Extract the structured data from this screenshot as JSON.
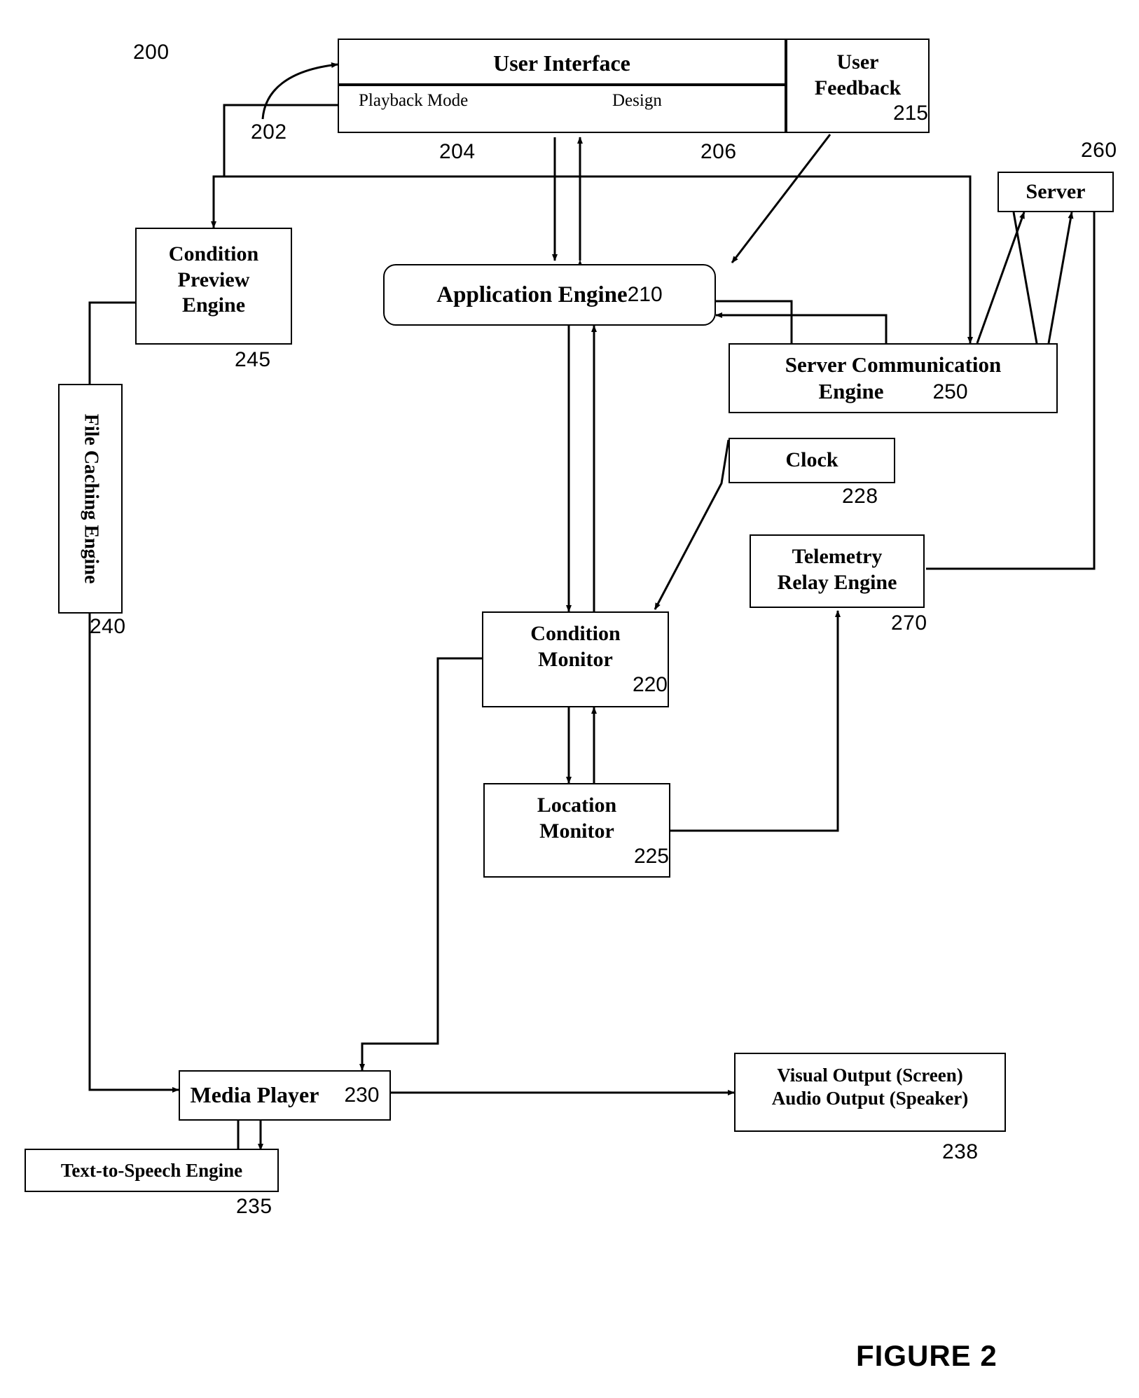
{
  "figure": {
    "caption": "FIGURE 2",
    "system_ref": "200",
    "ui_callout_ref": "202"
  },
  "blocks": {
    "user_interface": {
      "title": "User Interface",
      "tab_playback": "Playback Mode",
      "tab_design": "Design",
      "ref_playback": "204",
      "ref_design": "206"
    },
    "user_feedback": {
      "line1": "User",
      "line2": "Feedback",
      "ref": "215"
    },
    "server": {
      "label": "Server",
      "ref": "260"
    },
    "condition_preview_engine": {
      "line1": "Condition",
      "line2": "Preview",
      "line3": "Engine",
      "ref": "245"
    },
    "file_caching_engine": {
      "label": "File Caching Engine",
      "ref": "240"
    },
    "application_engine": {
      "label": "Application Engine",
      "ref": "210"
    },
    "server_communication_engine": {
      "line1": "Server Communication",
      "line2": "Engine",
      "ref": "250"
    },
    "clock": {
      "label": "Clock",
      "ref": "228"
    },
    "telemetry_relay_engine": {
      "line1": "Telemetry",
      "line2": "Relay Engine",
      "ref": "270"
    },
    "condition_monitor": {
      "line1": "Condition",
      "line2": "Monitor",
      "ref": "220"
    },
    "location_monitor": {
      "line1": "Location",
      "line2": "Monitor",
      "ref": "225"
    },
    "media_player": {
      "label": "Media Player",
      "ref": "230"
    },
    "text_to_speech_engine": {
      "label": "Text-to-Speech Engine",
      "ref": "235"
    },
    "output": {
      "line1": "Visual Output (Screen)",
      "line2": "Audio Output (Speaker)",
      "ref": "238"
    }
  },
  "colors": {
    "ink": "#000000",
    "paper": "#ffffff"
  }
}
